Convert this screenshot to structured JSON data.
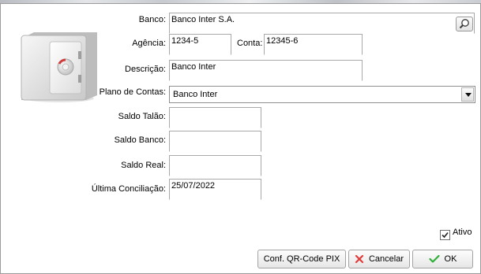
{
  "form": {
    "banco": {
      "label": "Banco:",
      "value": "Banco Inter S.A."
    },
    "agencia": {
      "label": "Agência:",
      "value": "1234-5"
    },
    "conta": {
      "label": "Conta:",
      "value": "12345-6"
    },
    "descricao": {
      "label": "Descrição:",
      "value": "Banco Inter"
    },
    "plano_de_contas": {
      "label": "Plano de Contas:",
      "value": "Banco Inter"
    },
    "saldo_talao": {
      "label": "Saldo Talão:",
      "value": ""
    },
    "saldo_banco": {
      "label": "Saldo Banco:",
      "value": ""
    },
    "saldo_real": {
      "label": "Saldo Real:",
      "value": ""
    },
    "ultima_conciliacao": {
      "label": "Última Conciliação:",
      "value": "25/07/2022"
    },
    "ativo": {
      "label": "Ativo",
      "checked": true
    }
  },
  "buttons": {
    "conf_qr": "Conf. QR-Code PIX",
    "cancelar": "Cancelar",
    "ok": "OK"
  },
  "icons": {
    "safe": "safe-icon",
    "search": "search-icon",
    "cancel": "x-icon",
    "ok": "check-icon"
  },
  "colors": {
    "cancel_icon": "#e03c3c",
    "ok_icon": "#2fae3a"
  }
}
